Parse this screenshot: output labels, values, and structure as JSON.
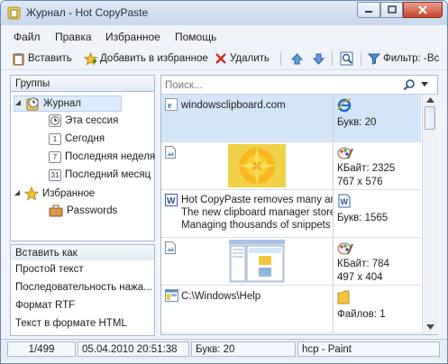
{
  "window": {
    "title": "Журнал - Hot CopyPaste"
  },
  "menu": {
    "items": [
      "Файл",
      "Правка",
      "Избранное",
      "Помощь"
    ]
  },
  "toolbar": {
    "paste": "Вставить",
    "add_favorite": "Добавить в избранное",
    "delete": "Удалить",
    "filter": "Фильтр: -Вс"
  },
  "groups_panel": {
    "header": "Группы",
    "root": "Журнал",
    "history_items": [
      {
        "label": "Эта сессия",
        "icon": "clock-icon"
      },
      {
        "label": "Сегодня",
        "icon": "calendar-day-1-icon",
        "glyph": "1"
      },
      {
        "label": "Последняя неделя",
        "icon": "calendar-day-7-icon",
        "glyph": "7"
      },
      {
        "label": "Последний месяц",
        "icon": "calendar-day-31-icon",
        "glyph": "31"
      }
    ],
    "favorites": "Избранное",
    "favorites_items": [
      {
        "label": "Passwords",
        "icon": "briefcase-icon"
      }
    ]
  },
  "paste_as_panel": {
    "header": "Вставить как",
    "items": [
      "Простой текст",
      "Последовательность нажа...",
      "Формат RTF",
      "Текст в формате HTML"
    ]
  },
  "search": {
    "placeholder": "Поиск..."
  },
  "clips": [
    {
      "type": "url",
      "icon": "ie-icon",
      "text": [
        "windowsclipboard.com"
      ],
      "info": [
        "Букв: 20"
      ],
      "info_icon": "ie-icon",
      "selected": true
    },
    {
      "type": "image",
      "icon": "image-file-icon",
      "info": [
        "КБайт: 2325",
        "767 x 576"
      ],
      "info_icon": "paint-icon"
    },
    {
      "type": "text",
      "icon": "word-icon",
      "text": [
        "Hot CopyPaste removes many ann",
        "The new clipboard manager stores",
        "Managing thousands of snippets c"
      ],
      "info": [
        "Букв: 1565"
      ],
      "info_icon": "word-icon"
    },
    {
      "type": "image",
      "icon": "image-file-icon",
      "info": [
        "КБайт: 784",
        "497 x 404"
      ],
      "info_icon": "paint-icon"
    },
    {
      "type": "files",
      "icon": "explorer-icon",
      "text": [
        "C:\\Windows\\Help"
      ],
      "info": [
        "Файлов: 1"
      ],
      "info_icon": "folder-icon"
    }
  ],
  "status": {
    "position": "1/499",
    "datetime": "05.04.2010 20:51:38",
    "chars": "Букв: 20",
    "source": "hcp - Paint"
  },
  "colors": {
    "selection": "#d3e5f8",
    "border": "#a7b8cf",
    "accent": "#3b6fb6"
  }
}
